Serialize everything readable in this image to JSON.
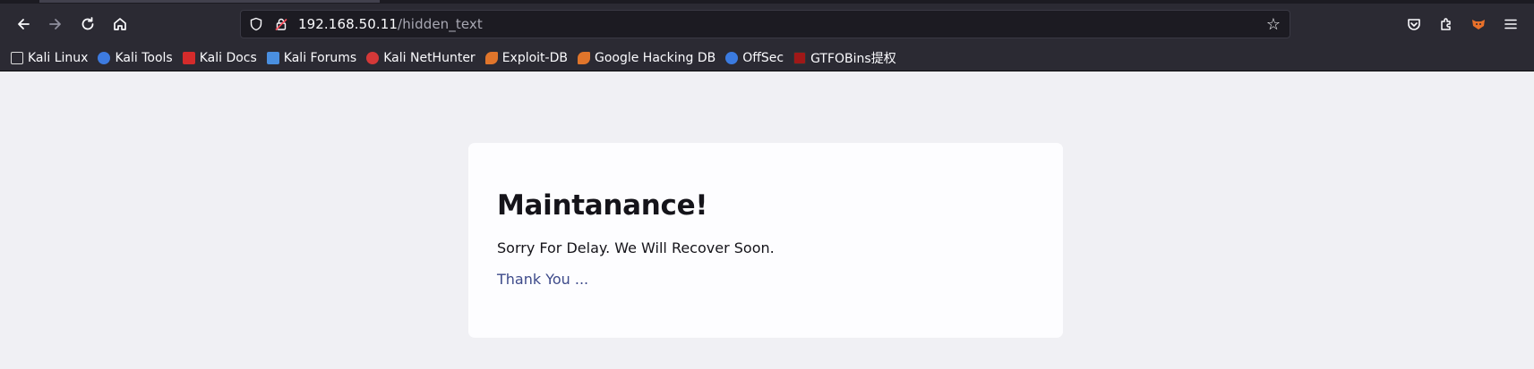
{
  "url": {
    "host": "192.168.50.11",
    "path": "/hidden_text"
  },
  "toolbar": {
    "back_icon": "arrow-left-icon",
    "forward_icon": "arrow-right-icon",
    "reload_icon": "reload-icon",
    "home_icon": "home-icon"
  },
  "bookmarks": [
    {
      "label": "Kali Linux",
      "color": "#e6e6e6"
    },
    {
      "label": "Kali Tools",
      "color": "#3d7be0"
    },
    {
      "label": "Kali Docs",
      "color": "#d42b2b"
    },
    {
      "label": "Kali Forums",
      "color": "#4a8fe0"
    },
    {
      "label": "Kali NetHunter",
      "color": "#d43838"
    },
    {
      "label": "Exploit-DB",
      "color": "#e0752b"
    },
    {
      "label": "Google Hacking DB",
      "color": "#e0752b"
    },
    {
      "label": "OffSec",
      "color": "#3b7be0"
    },
    {
      "label": "GTFOBins提权",
      "color": "#a01818"
    }
  ],
  "page": {
    "heading": "Maintanance!",
    "message": "Sorry For Delay. We Will Recover Soon.",
    "thanks": "Thank You ..."
  }
}
